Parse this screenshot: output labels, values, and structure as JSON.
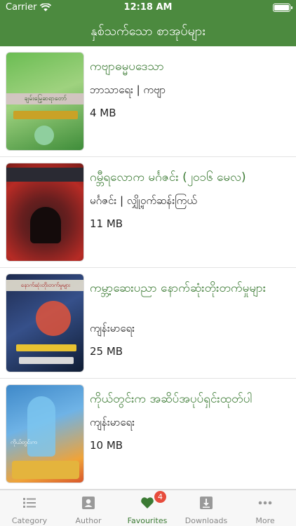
{
  "status_bar": {
    "carrier": "Carrier",
    "time": "12:18 AM"
  },
  "header": {
    "title": "နှစ်သက်သော စာအုပ်များ"
  },
  "books": [
    {
      "title": "ကဗျာဓမ္မပဒေသာ",
      "subtitle": "ဘာသာရေး | ကဗျာ",
      "size": "4 MB",
      "cover_text": "ချမ်းမြေ့ဆရာတော်"
    },
    {
      "title": "ဂမ္ဘီရလောက မင်္ဂဇင်း (၂၀၁၆ မေလ)",
      "subtitle": "မင်္ဂဇင်း | လျှို့ဝှက်ဆန်းကြယ်",
      "size": "11 MB",
      "cover_text": ""
    },
    {
      "title": "ကမ္ဘာ့ဆေးပညာ နောက်ဆုံးတိုးတက်မှုများ",
      "subtitle": "ကျန်းမာရေး",
      "size": "25 MB",
      "cover_text": "နောက်ဆုံးတိုးတက်မှုများ"
    },
    {
      "title": "ကိုယ်တွင်းက အဆိပ်အပုပ်ရှင်းထုတ်ပါ",
      "subtitle": "ကျန်းမာရေး",
      "size": "10 MB",
      "cover_text": "ကိုယ်တွင်းက"
    }
  ],
  "tabs": [
    {
      "label": "Category",
      "icon": "list-icon"
    },
    {
      "label": "Author",
      "icon": "person-card-icon"
    },
    {
      "label": "Favourites",
      "icon": "heart-icon",
      "badge": "4",
      "active": true
    },
    {
      "label": "Downloads",
      "icon": "download-icon"
    },
    {
      "label": "More",
      "icon": "more-dots-icon"
    }
  ],
  "colors": {
    "header": "#4c8a3f",
    "accent": "#3b7a33",
    "badge": "#e74c3c"
  }
}
